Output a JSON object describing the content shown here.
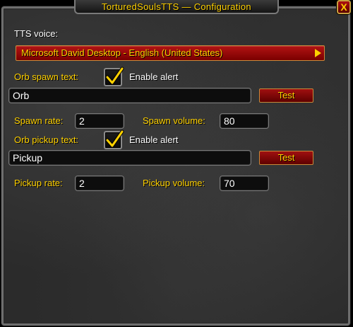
{
  "window": {
    "title": "TorturedSoulsTTS — Configuration",
    "close_label": "X"
  },
  "tts_voice": {
    "label": "TTS voice:",
    "selected": "Microsoft David Desktop - English (United States)"
  },
  "orb_spawn": {
    "label": "Orb spawn text:",
    "checkbox_label": "Enable alert",
    "checked": true,
    "text_value": "Orb",
    "test_label": "Test",
    "rate_label": "Spawn rate:",
    "rate_value": "2",
    "volume_label": "Spawn volume:",
    "volume_value": "80"
  },
  "orb_pickup": {
    "label": "Orb pickup text:",
    "checkbox_label": "Enable alert",
    "checked": true,
    "text_value": "Pickup",
    "test_label": "Test",
    "rate_label": "Pickup rate:",
    "rate_value": "2",
    "volume_label": "Pickup volume:",
    "volume_value": "70"
  },
  "colors": {
    "label_gold": "#ffd100",
    "button_red": "#a01010",
    "frame_bg": "#2b2b2b"
  }
}
